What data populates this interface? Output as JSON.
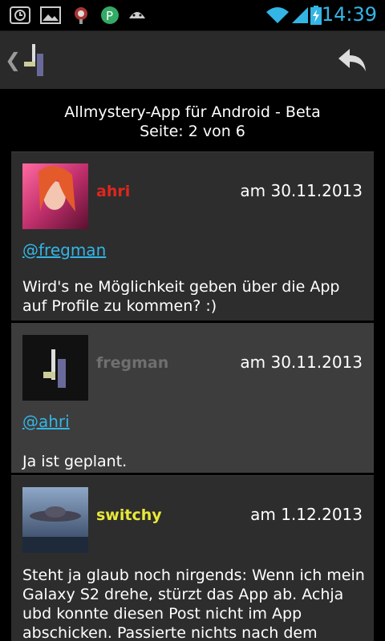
{
  "status_bar": {
    "time": "14:39",
    "icons": [
      "alarm-icon",
      "gallery-icon",
      "notification-icon",
      "p-app-icon",
      "android-icon",
      "wifi-icon",
      "signal-icon",
      "battery-charging-icon"
    ],
    "accent_color": "#33b5e5"
  },
  "thread": {
    "title": "Allmystery-App für Android - Beta",
    "page": "Seite: 2 von 6"
  },
  "posts": [
    {
      "username": "ahri",
      "username_color": "#e0261d",
      "date": "am 30.11.2013",
      "mention": "@fregman",
      "text": "Wird's ne Möglichkeit geben über die App auf Profile zu kommen? :)"
    },
    {
      "username": "fregman",
      "username_color": "#6f6f6f",
      "date": "am 30.11.2013",
      "mention": "@ahri",
      "text": "Ja ist geplant."
    },
    {
      "username": "switchy",
      "username_color": "#e8e83a",
      "date": "am 1.12.2013",
      "mention": "",
      "text": "Steht ja glaub noch nirgends: Wenn ich mein Galaxy S2 drehe, stürzt das App ab. Achja ubd konnte diesen Post nicht im App abschicken. Passierte nichts nach dem"
    }
  ]
}
